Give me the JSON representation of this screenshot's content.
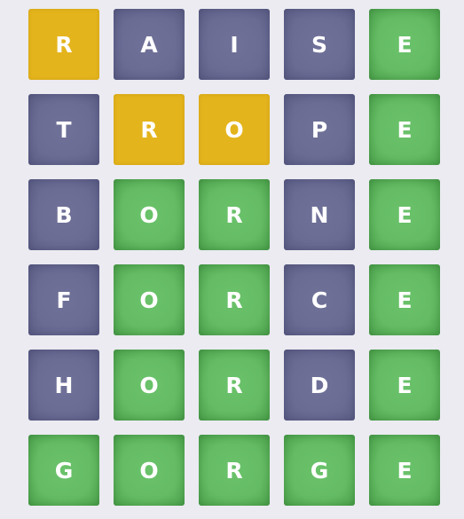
{
  "colors": {
    "background": "#ebebf1",
    "absent": "#6a6c94",
    "correct": "#64bb63",
    "present": "#e4b41c",
    "letter": "#ffffff"
  },
  "board": {
    "rows": [
      {
        "word": "RAISE",
        "tiles": [
          {
            "letter": "R",
            "state": "present"
          },
          {
            "letter": "A",
            "state": "absent"
          },
          {
            "letter": "I",
            "state": "absent"
          },
          {
            "letter": "S",
            "state": "absent"
          },
          {
            "letter": "E",
            "state": "correct"
          }
        ]
      },
      {
        "word": "TROPE",
        "tiles": [
          {
            "letter": "T",
            "state": "absent"
          },
          {
            "letter": "R",
            "state": "present"
          },
          {
            "letter": "O",
            "state": "present"
          },
          {
            "letter": "P",
            "state": "absent"
          },
          {
            "letter": "E",
            "state": "correct"
          }
        ]
      },
      {
        "word": "BORNE",
        "tiles": [
          {
            "letter": "B",
            "state": "absent"
          },
          {
            "letter": "O",
            "state": "correct"
          },
          {
            "letter": "R",
            "state": "correct"
          },
          {
            "letter": "N",
            "state": "absent"
          },
          {
            "letter": "E",
            "state": "correct"
          }
        ]
      },
      {
        "word": "FORCE",
        "tiles": [
          {
            "letter": "F",
            "state": "absent"
          },
          {
            "letter": "O",
            "state": "correct"
          },
          {
            "letter": "R",
            "state": "correct"
          },
          {
            "letter": "C",
            "state": "absent"
          },
          {
            "letter": "E",
            "state": "correct"
          }
        ]
      },
      {
        "word": "HORDE",
        "tiles": [
          {
            "letter": "H",
            "state": "absent"
          },
          {
            "letter": "O",
            "state": "correct"
          },
          {
            "letter": "R",
            "state": "correct"
          },
          {
            "letter": "D",
            "state": "absent"
          },
          {
            "letter": "E",
            "state": "correct"
          }
        ]
      },
      {
        "word": "GORGE",
        "tiles": [
          {
            "letter": "G",
            "state": "correct"
          },
          {
            "letter": "O",
            "state": "correct"
          },
          {
            "letter": "R",
            "state": "correct"
          },
          {
            "letter": "G",
            "state": "correct"
          },
          {
            "letter": "E",
            "state": "correct"
          }
        ]
      }
    ]
  }
}
